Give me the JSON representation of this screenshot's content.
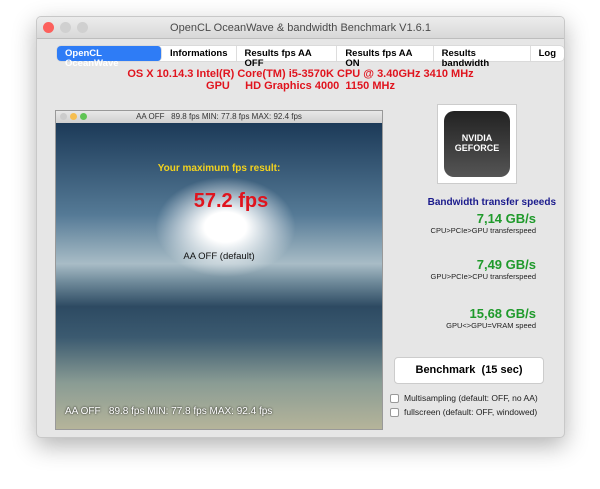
{
  "window": {
    "title": "OpenCL OceanWave & bandwidth Benchmark V1.6.1"
  },
  "tabs": [
    "OpenCL OceanWave",
    "Informations",
    "Results fps AA OFF",
    "Results fps AA ON",
    "Results bandwidth",
    "Log"
  ],
  "system": {
    "cpu_line": "OS X 10.14.3 Intel(R) Core(TM) i5-3570K CPU @ 3.40GHz 3410 MHz",
    "gpu_line": "GPU     HD Graphics 4000  1150 MHz"
  },
  "render": {
    "title": "AA OFF   89.8 fps MIN: 77.8 fps MAX: 92.4 fps",
    "heading": "Your maximum fps result:",
    "fps": "57.2 fps",
    "mode": "AA OFF (default)",
    "overlay": "AA OFF   89.8 fps MIN: 77.8 fps MAX: 92.4 fps"
  },
  "logo": {
    "brand": "NVIDIA",
    "sub": "GEFORCE"
  },
  "bandwidth": {
    "title": "Bandwidth transfer speeds",
    "items": [
      {
        "value": "7,14 GB/s",
        "label": "CPU>PCIe>GPU transferspeed"
      },
      {
        "value": "7,49 GB/s",
        "label": "GPU>PCIe>CPU transferspeed"
      },
      {
        "value": "15,68 GB/s",
        "label": "GPU<>GPU=VRAM speed"
      }
    ]
  },
  "benchmark_button": "Benchmark  (15 sec)",
  "options": [
    {
      "label": "Multisampling (default: OFF, no AA)",
      "checked": false
    },
    {
      "label": "fullscreen (default: OFF, windowed)",
      "checked": false
    }
  ]
}
